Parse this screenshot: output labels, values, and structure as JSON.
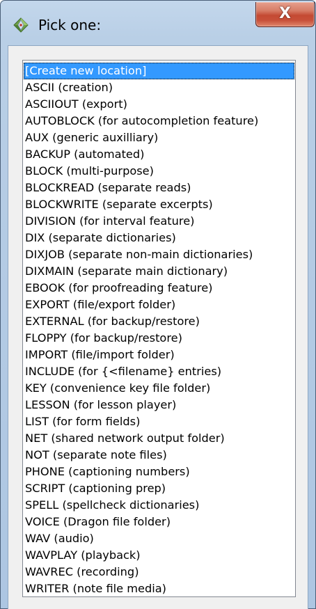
{
  "window": {
    "title": "Pick one:",
    "close_label": "X",
    "title_icon": "diamond-app-icon"
  },
  "colors": {
    "selection": "#3399ff",
    "close_button": "#c7432c",
    "frame": "#b4cbe4"
  },
  "list": {
    "selected_index": 0,
    "items": [
      "[Create new location]",
      "ASCII (creation)",
      "ASCIIOUT (export)",
      "AUTOBLOCK (for autocompletion feature)",
      "AUX (generic auxilliary)",
      "BACKUP (automated)",
      "BLOCK (multi-purpose)",
      "BLOCKREAD (separate reads)",
      "BLOCKWRITE (separate excerpts)",
      "DIVISION (for interval feature)",
      "DIX (separate dictionaries)",
      "DIXJOB (separate non-main dictionaries)",
      "DIXMAIN (separate main dictionary)",
      "EBOOK (for proofreading feature)",
      "EXPORT (file/export folder)",
      "EXTERNAL (for backup/restore)",
      "FLOPPY (for backup/restore)",
      "IMPORT (file/import folder)",
      "INCLUDE (for {<filename} entries)",
      "KEY (convenience key file folder)",
      "LESSON (for lesson player)",
      "LIST (for form fields)",
      "NET (shared network output folder)",
      "NOT (separate note files)",
      "PHONE (captioning numbers)",
      "SCRIPT (captioning prep)",
      "SPELL (spellcheck dictionaries)",
      "VOICE (Dragon file folder)",
      "WAV (audio)",
      "WAVPLAY (playback)",
      "WAVREC (recording)",
      "WRITER (note file media)"
    ]
  }
}
